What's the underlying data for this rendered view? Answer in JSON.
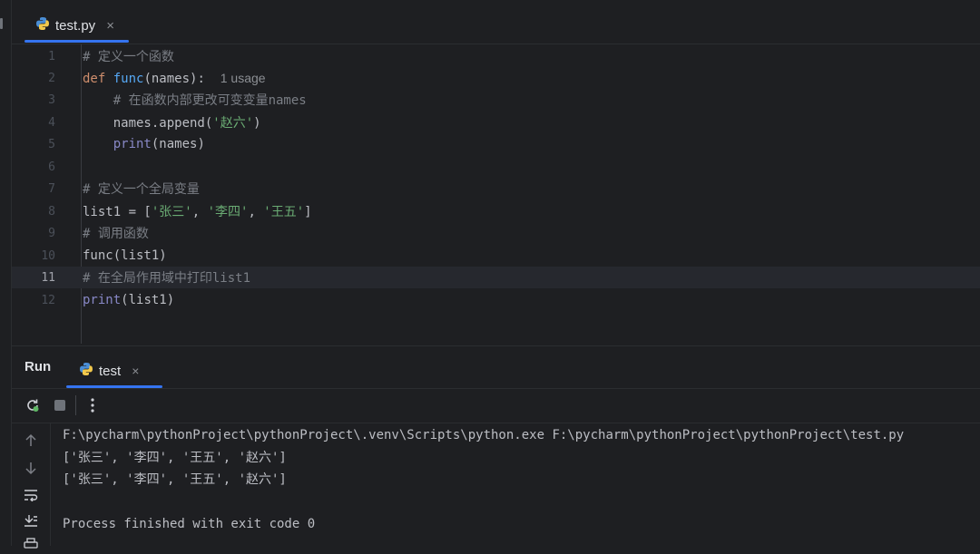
{
  "editor_tab": {
    "label": "test.py",
    "close": "×"
  },
  "code_lines": [
    {
      "num": "1",
      "text": "# 定义一个函数"
    },
    {
      "num": "2",
      "kw": "def",
      "fn": "func",
      "rest": "(names):",
      "hint": "1 usage"
    },
    {
      "num": "3",
      "text": "# 在函数内部更改可变变量names"
    },
    {
      "num": "4",
      "pre": "names.append(",
      "str": "'赵六'",
      "post": ")"
    },
    {
      "num": "5",
      "bi": "print",
      "rest": "(names)"
    },
    {
      "num": "6"
    },
    {
      "num": "7",
      "text": "# 定义一个全局变量"
    },
    {
      "num": "8",
      "pre": "list1 = [",
      "s1": "'张三'",
      "s2": "'李四'",
      "s3": "'王五'",
      "post": "]"
    },
    {
      "num": "9",
      "text": "# 调用函数"
    },
    {
      "num": "10",
      "text": "func(list1)"
    },
    {
      "num": "11",
      "text": "# 在全局作用域中打印list1"
    },
    {
      "num": "12",
      "bi": "print",
      "rest": "(list1)"
    }
  ],
  "run_panel": {
    "title": "Run",
    "tab_label": "test",
    "tab_close": "×",
    "console": [
      "F:\\pycharm\\pythonProject\\pythonProject\\.venv\\Scripts\\python.exe F:\\pycharm\\pythonProject\\pythonProject\\test.py",
      "['张三', '李四', '王五', '赵六']",
      "['张三', '李四', '王五', '赵六']",
      "",
      "Process finished with exit code 0"
    ]
  },
  "icons": [
    "python-icon",
    "rerun-icon",
    "stop-icon",
    "more-icon",
    "scroll-up-icon",
    "scroll-down-icon",
    "soft-wrap-icon",
    "scroll-to-end-icon",
    "print-icon"
  ],
  "colors": {
    "accent": "#3574f0",
    "keyword": "#cf8e6d",
    "function": "#56a8f5",
    "string": "#6aab73",
    "comment": "#7a7e85"
  }
}
